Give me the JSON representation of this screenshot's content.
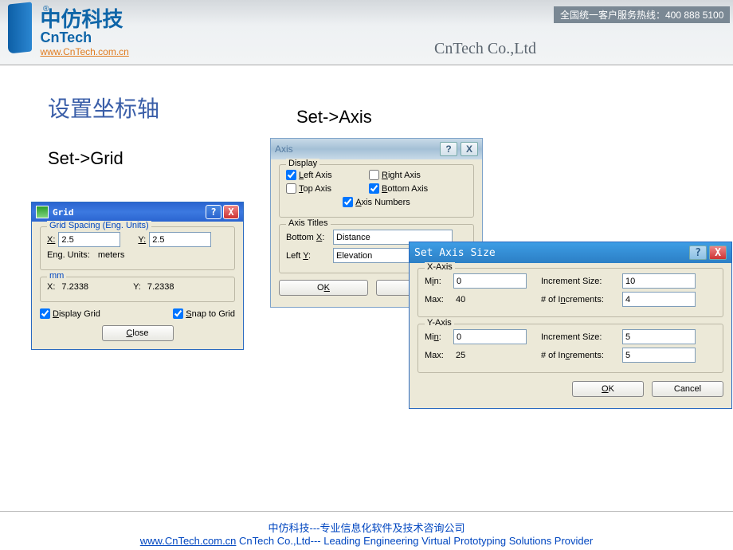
{
  "header": {
    "logo_cn": "中仿科技",
    "logo_en": "CnTech",
    "logo_url": "www.CnTech.com.cn",
    "logo_r": "®",
    "hotline": "全国统一客户服务热线：400 888 5100",
    "company": "CnTech Co.,Ltd"
  },
  "labels": {
    "title_cn": "设置坐标轴",
    "set_grid": "Set->Grid",
    "set_axis": "Set->Axis"
  },
  "grid": {
    "title": "Grid",
    "help": "?",
    "close": "X",
    "spacing_legend": "Grid Spacing (Eng. Units)",
    "x_label": "X:",
    "x_value": "2.5",
    "y_label": "Y:",
    "y_value": "2.5",
    "units_label": "Eng. Units:",
    "units_value": "meters",
    "mm_legend": "mm",
    "mm_x_label": "X:",
    "mm_x_value": "7.2338",
    "mm_y_label": "Y:",
    "mm_y_value": "7.2338",
    "display_grid": "Display Grid",
    "snap_grid": "Snap to Grid",
    "close_btn": "Close"
  },
  "axis": {
    "title": "Axis",
    "display_legend": "Display",
    "left_axis": "Left Axis",
    "right_axis": "Right Axis",
    "top_axis": "Top Axis",
    "bottom_axis": "Bottom Axis",
    "axis_numbers": "Axis Numbers",
    "titles_legend": "Axis Titles",
    "bottom_x_label": "Bottom X:",
    "bottom_x_value": "Distance",
    "left_y_label": "Left Y:",
    "left_y_value": "Elevation",
    "ok": "OK"
  },
  "size": {
    "title": "Set Axis Size",
    "help": "?",
    "close": "X",
    "x_legend": "X-Axis",
    "y_legend": "Y-Axis",
    "min_label": "Min:",
    "max_label": "Max:",
    "inc_size_label": "Increment Size:",
    "num_inc_label": "# of Increments:",
    "x_min": "0",
    "x_max": "40",
    "x_inc_size": "10",
    "x_num_inc": "4",
    "y_min": "0",
    "y_max": "25",
    "y_inc_size": "5",
    "y_num_inc": "5",
    "ok": "OK",
    "cancel": "Cancel"
  },
  "footer": {
    "line1": "中仿科技---专业信息化软件及技术咨询公司",
    "link": "www.CnTech.com.cn",
    "line2_rest": " CnTech Co.,Ltd--- Leading Engineering Virtual Prototyping Solutions Provider"
  }
}
